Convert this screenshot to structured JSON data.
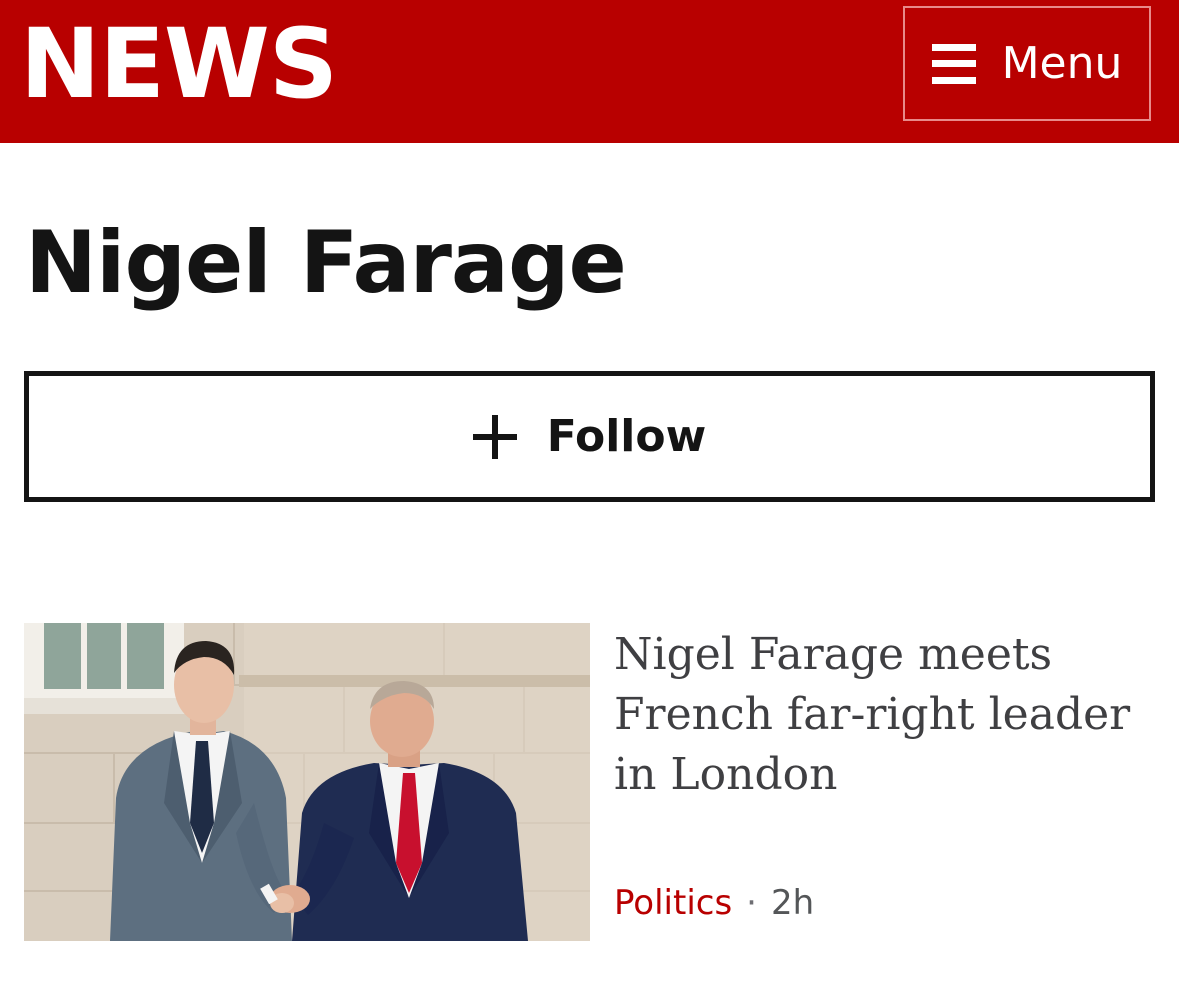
{
  "header": {
    "logo_text": "NEWS",
    "menu_label": "Menu",
    "menu_icon": "hamburger-icon",
    "brand_color": "#b80000"
  },
  "page": {
    "title": "Nigel Farage",
    "follow_label": "Follow",
    "follow_icon": "plus-icon"
  },
  "stories": [
    {
      "headline": "Nigel Farage meets French far-right leader in London",
      "topic": "Politics",
      "separator": "·",
      "time": "2h",
      "topic_color": "#b80000"
    }
  ]
}
